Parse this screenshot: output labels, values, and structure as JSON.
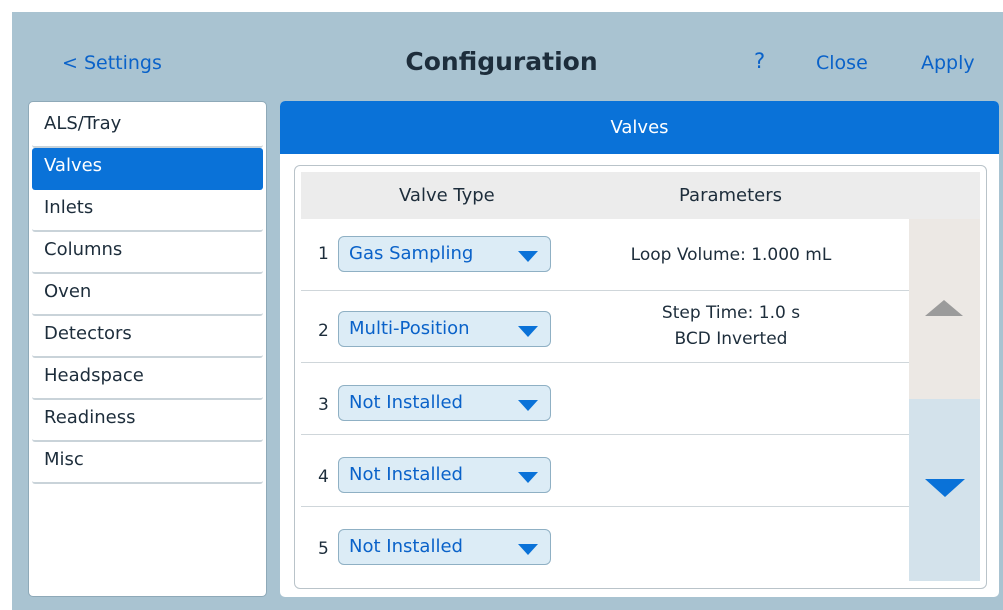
{
  "header": {
    "back_label": "< Settings",
    "title": "Configuration",
    "help_label": "?",
    "close_label": "Close",
    "apply_label": "Apply"
  },
  "sidebar": {
    "items": [
      {
        "label": "ALS/Tray"
      },
      {
        "label": "Valves"
      },
      {
        "label": "Inlets"
      },
      {
        "label": "Columns"
      },
      {
        "label": "Oven"
      },
      {
        "label": "Detectors"
      },
      {
        "label": "Headspace"
      },
      {
        "label": "Readiness"
      },
      {
        "label": "Misc"
      }
    ],
    "active": "Valves"
  },
  "panel": {
    "title": "Valves",
    "columns": {
      "valve_type": "Valve Type",
      "parameters": "Parameters"
    },
    "rows": [
      {
        "num": "1",
        "type": "Gas Sampling",
        "params": [
          "Loop Volume: 1.000 mL"
        ]
      },
      {
        "num": "2",
        "type": "Multi-Position",
        "params": [
          "Step Time: 1.0 s",
          "BCD Inverted"
        ]
      },
      {
        "num": "3",
        "type": "Not Installed",
        "params": []
      },
      {
        "num": "4",
        "type": "Not Installed",
        "params": []
      },
      {
        "num": "5",
        "type": "Not Installed",
        "params": []
      }
    ]
  },
  "icons": {
    "scroll_up": "triangle-up-icon",
    "scroll_down": "triangle-down-icon",
    "dropdown": "caret-down-icon"
  },
  "colors": {
    "accent": "#0a72d8",
    "background": "#a9c3d1",
    "link": "#0a62c9"
  }
}
